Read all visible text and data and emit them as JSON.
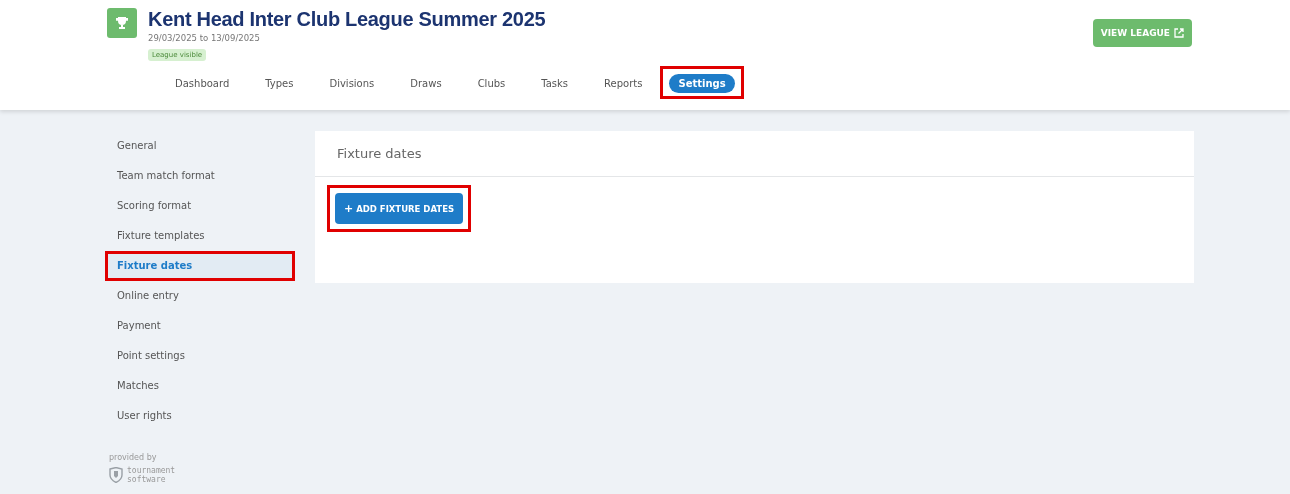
{
  "league": {
    "title": "Kent Head Inter Club League Summer 2025",
    "dates": "29/03/2025 to 13/09/2025",
    "badge": "League visible",
    "view_button": "VIEW LEAGUE"
  },
  "tabs": [
    {
      "label": "Dashboard",
      "selected": false,
      "highlighted": false
    },
    {
      "label": "Types",
      "selected": false,
      "highlighted": false
    },
    {
      "label": "Divisions",
      "selected": false,
      "highlighted": false
    },
    {
      "label": "Draws",
      "selected": false,
      "highlighted": false
    },
    {
      "label": "Clubs",
      "selected": false,
      "highlighted": false
    },
    {
      "label": "Tasks",
      "selected": false,
      "highlighted": false
    },
    {
      "label": "Reports",
      "selected": false,
      "highlighted": false
    },
    {
      "label": "Settings",
      "selected": true,
      "highlighted": true
    }
  ],
  "sidebar": {
    "items": [
      {
        "label": "General",
        "selected": false,
        "highlighted": false
      },
      {
        "label": "Team match format",
        "selected": false,
        "highlighted": false
      },
      {
        "label": "Scoring format",
        "selected": false,
        "highlighted": false
      },
      {
        "label": "Fixture templates",
        "selected": false,
        "highlighted": false
      },
      {
        "label": "Fixture dates",
        "selected": true,
        "highlighted": true
      },
      {
        "label": "Online entry",
        "selected": false,
        "highlighted": false
      },
      {
        "label": "Payment",
        "selected": false,
        "highlighted": false
      },
      {
        "label": "Point settings",
        "selected": false,
        "highlighted": false
      },
      {
        "label": "Matches",
        "selected": false,
        "highlighted": false
      },
      {
        "label": "User rights",
        "selected": false,
        "highlighted": false
      }
    ],
    "footer": {
      "caption": "provided by",
      "brand_line_1": "tournament",
      "brand_line_2": "software"
    }
  },
  "panel": {
    "title": "Fixture dates",
    "button": {
      "icon": "+",
      "label": "ADD FIXTURE DATES",
      "highlighted": true
    }
  }
}
